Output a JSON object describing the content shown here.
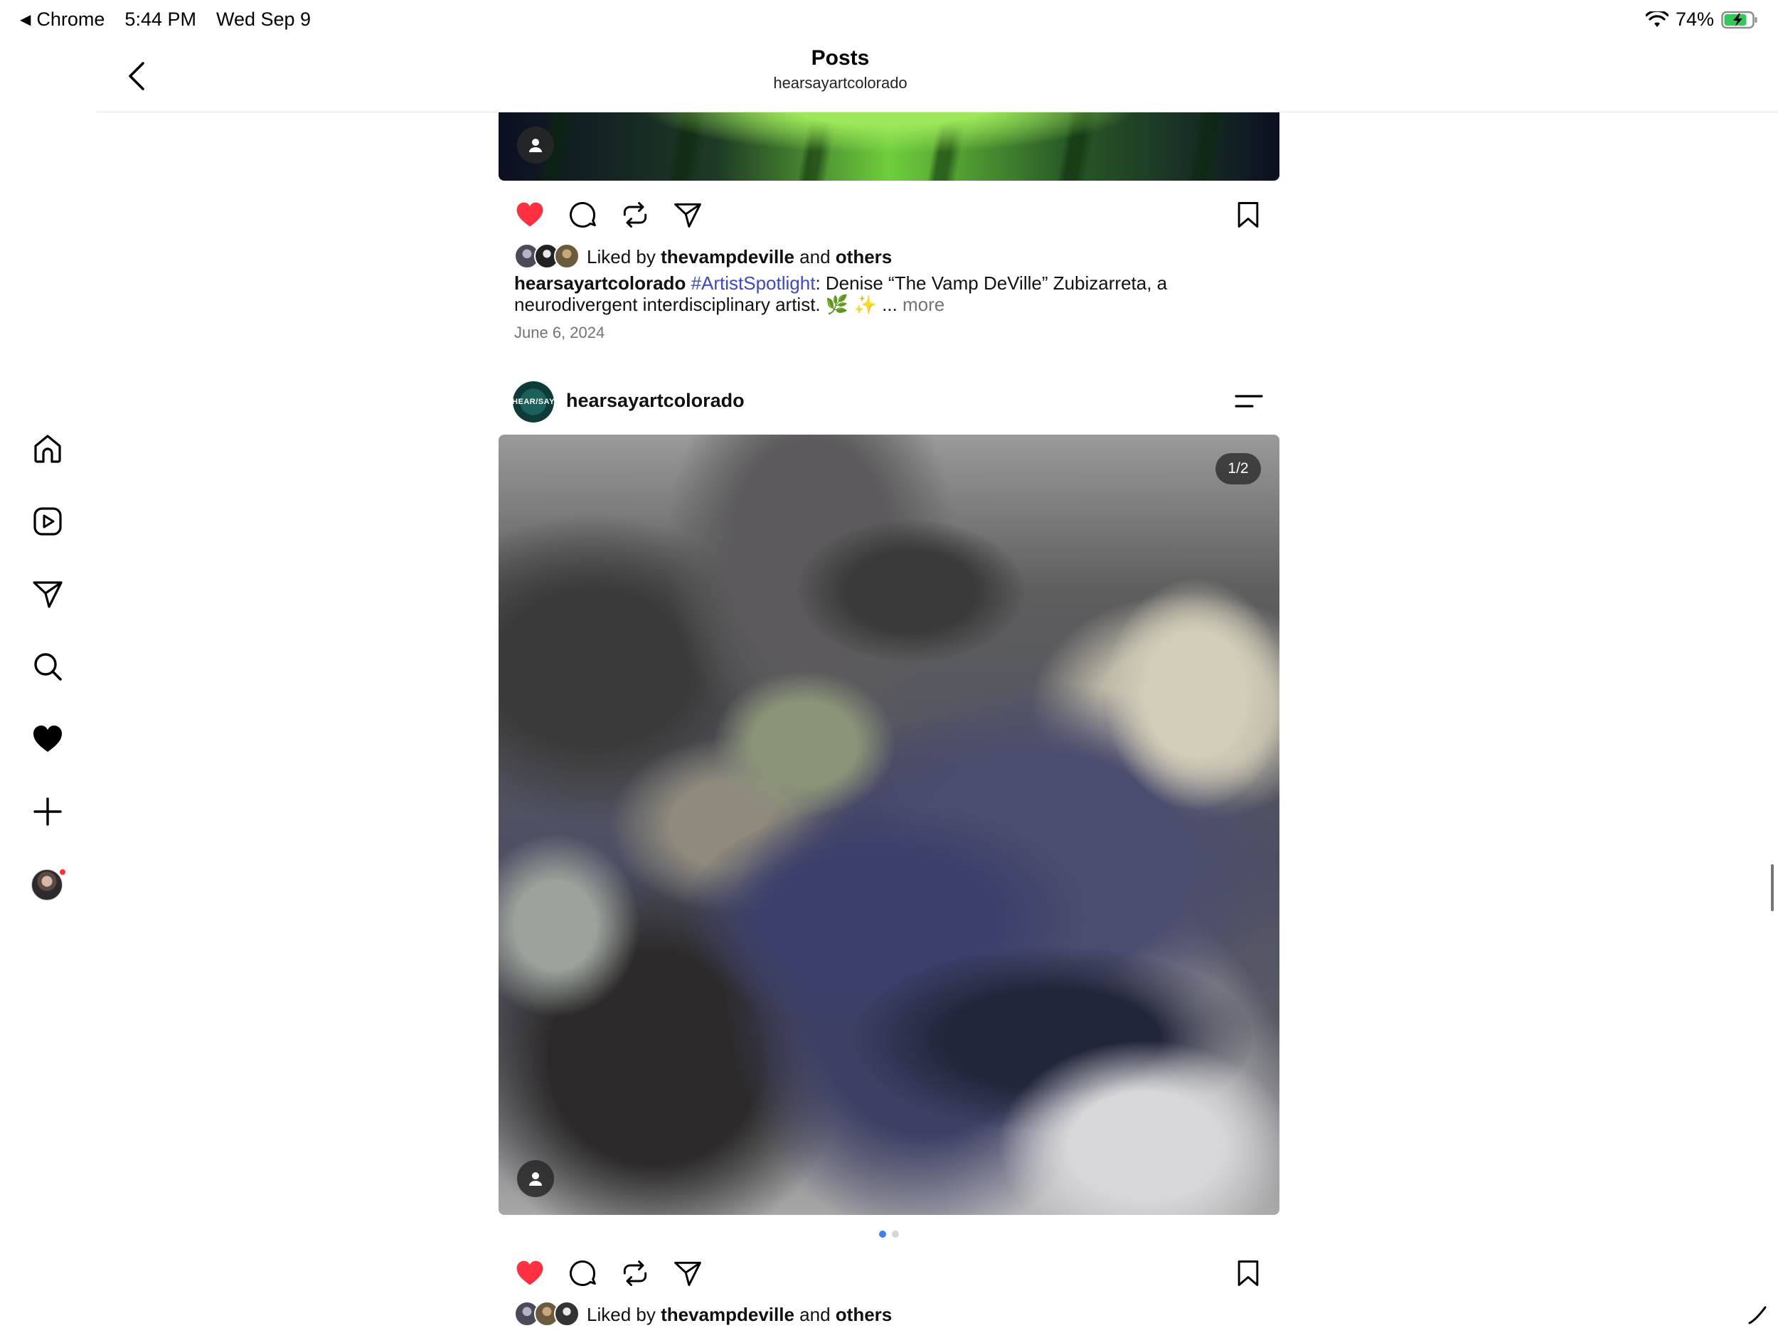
{
  "status_bar": {
    "back_app": "Chrome",
    "time": "5:44 PM",
    "date": "Wed Sep 9",
    "battery": "74%"
  },
  "header": {
    "title": "Posts",
    "subtitle": "hearsayartcolorado"
  },
  "sidebar": {
    "items": [
      {
        "name": "home",
        "icon": "home-icon"
      },
      {
        "name": "reels",
        "icon": "reels-icon"
      },
      {
        "name": "messages",
        "icon": "send-icon"
      },
      {
        "name": "search",
        "icon": "search-icon"
      },
      {
        "name": "activity",
        "icon": "heart-icon"
      },
      {
        "name": "create",
        "icon": "plus-icon"
      },
      {
        "name": "profile",
        "icon": "avatar"
      }
    ]
  },
  "post1": {
    "liked_by_prefix": "Liked by",
    "liked_by_user": "thevampdeville",
    "liked_by_and": "and",
    "liked_by_others": "others",
    "caption_user": "hearsayartcolorado",
    "caption_hashtag": "#ArtistSpotlight",
    "caption_text": ": Denise “The Vamp DeVille” Zubizarreta, a neurodivergent interdisciplinary artist. 🌿 ✨ ...",
    "caption_more": "more",
    "date": "June 6, 2024",
    "liked": true
  },
  "post2": {
    "username": "hearsayartcolorado",
    "avatar_text": "HEAR/SAY",
    "image_counter": "1/2",
    "carousel_total": 2,
    "carousel_active": 0,
    "liked_by_prefix": "Liked by",
    "liked_by_user": "thevampdeville",
    "liked_by_and": "and",
    "liked_by_others": "others",
    "liked": true
  },
  "colors": {
    "like_red": "#ff3040",
    "hashtag_blue": "#3b48c9",
    "muted_gray": "#737373",
    "dot_active": "#3f7ff5"
  }
}
